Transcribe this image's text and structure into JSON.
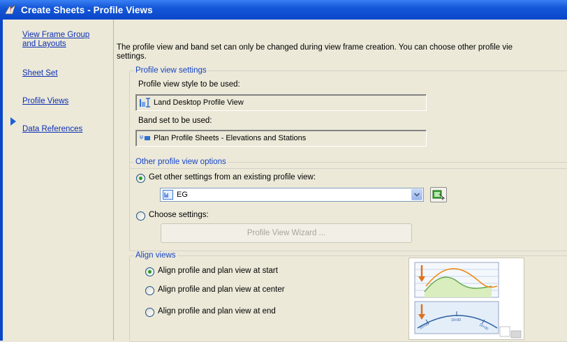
{
  "window": {
    "title": "Create Sheets - Profile Views"
  },
  "sidebar": {
    "items": [
      {
        "label": "View Frame Group\nand Layouts"
      },
      {
        "label": "Sheet Set"
      },
      {
        "label": "Profile Views"
      },
      {
        "label": "Data References"
      }
    ]
  },
  "intro_text": "The profile view and band set can only be changed during view frame creation. You can choose other profile vie\nsettings.",
  "profile_view_settings": {
    "legend": "Profile view settings",
    "style_label": "Profile view style to be used:",
    "style_value": "Land Desktop Profile View",
    "band_label": "Band set to be used:",
    "band_value": "Plan Profile Sheets - Elevations and Stations"
  },
  "other_options": {
    "legend": "Other profile view options",
    "existing_label": "Get other settings from an existing profile view:",
    "existing_value": "EG",
    "choose_label": "Choose settings:",
    "wizard_label": "Profile View Wizard ..."
  },
  "align_views": {
    "legend": "Align views",
    "options": [
      {
        "label": "Align profile and plan view at start",
        "selected": true
      },
      {
        "label": "Align profile and plan view at center",
        "selected": false
      },
      {
        "label": "Align profile and plan view at end",
        "selected": false
      }
    ],
    "preview_stations": [
      "10+00",
      "10+00",
      "10+00"
    ]
  },
  "colors": {
    "title_bar": "#0a47c9",
    "link": "#0b2fb4",
    "legend": "#1544c7",
    "panel": "#ece9d8"
  }
}
